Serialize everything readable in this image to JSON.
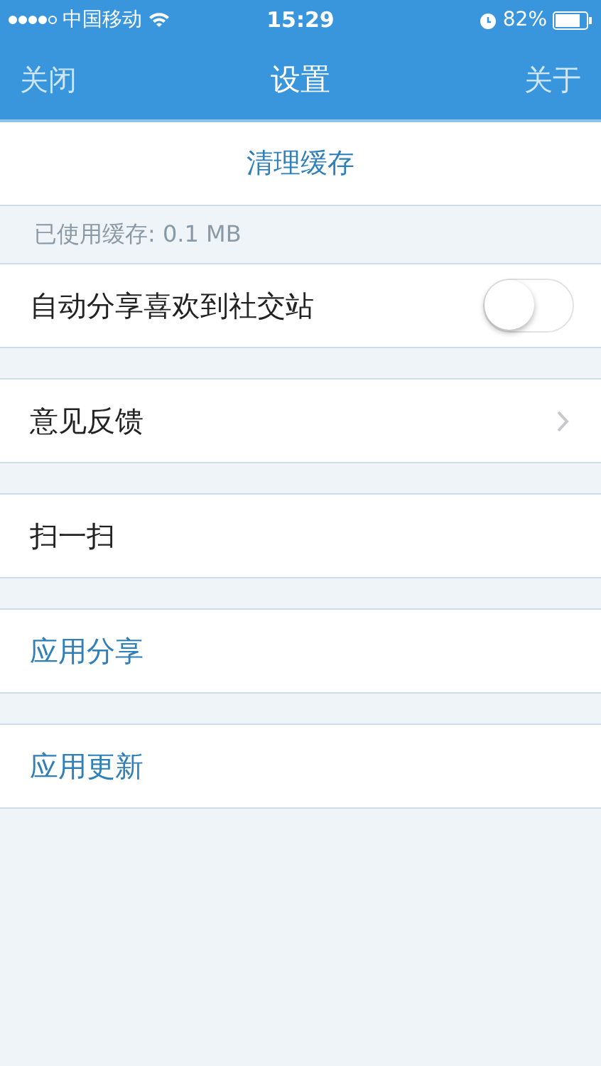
{
  "status_bar": {
    "carrier": "中国移动",
    "time": "15:29",
    "battery": "82%"
  },
  "nav": {
    "left": "关闭",
    "title": "设置",
    "right": "关于"
  },
  "clear_cache": {
    "label": "清理缓存"
  },
  "cache_info": "已使用缓存: 0.1 MB",
  "rows": [
    {
      "kind": "toggle",
      "label": "自动分享喜欢到社交站",
      "on": false
    },
    {
      "kind": "disclosure",
      "label": "意见反馈"
    },
    {
      "kind": "plain",
      "label": "扫一扫"
    },
    {
      "kind": "link",
      "label": "应用分享"
    },
    {
      "kind": "link",
      "label": "应用更新"
    }
  ]
}
